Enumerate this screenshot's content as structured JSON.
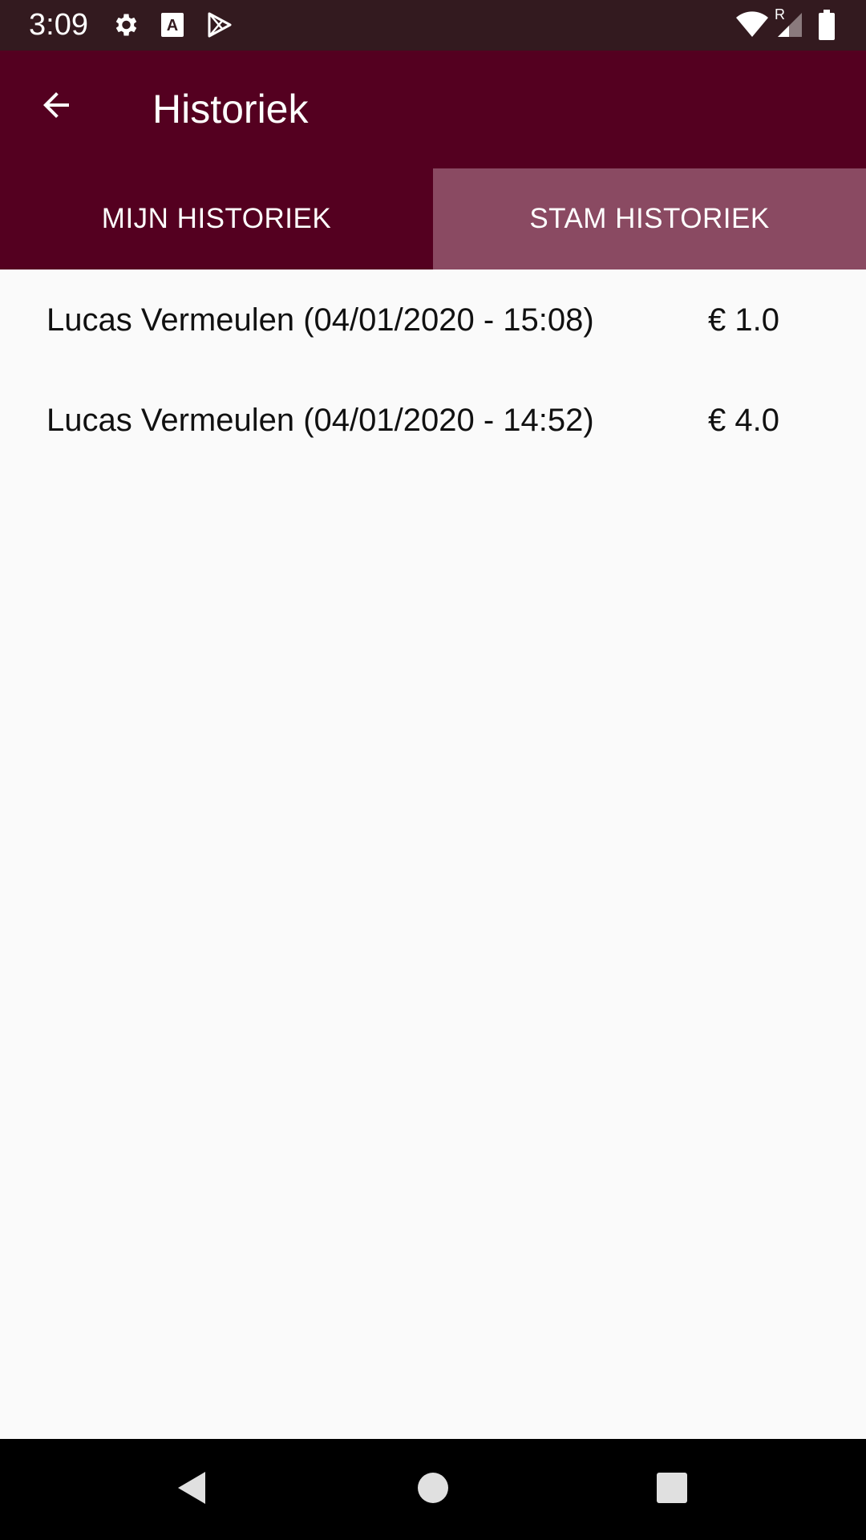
{
  "status_bar": {
    "time": "3:09",
    "icons": [
      "gear-icon",
      "font-a-icon",
      "play-store-icon",
      "wifi-icon",
      "signal-icon",
      "battery-icon"
    ],
    "signal_roaming_label": "R"
  },
  "app_bar": {
    "title": "Historiek",
    "back_icon": "arrow-back-icon"
  },
  "tabs": [
    {
      "label": "MIJN HISTORIEK",
      "selected": false
    },
    {
      "label": "STAM HISTORIEK",
      "selected": true
    }
  ],
  "history": [
    {
      "description": "Lucas Vermeulen (04/01/2020 - 15:08)",
      "amount": "€ 1.0"
    },
    {
      "description": "Lucas Vermeulen (04/01/2020 - 14:52)",
      "amount": "€ 4.0"
    }
  ],
  "nav_bar": {
    "icons": [
      "back-triangle-icon",
      "home-circle-icon",
      "recents-square-icon"
    ]
  },
  "colors": {
    "status_bar": "#331a1f",
    "primary": "#540020",
    "tab_selected": "#8a4a62",
    "background": "#fafafa"
  }
}
